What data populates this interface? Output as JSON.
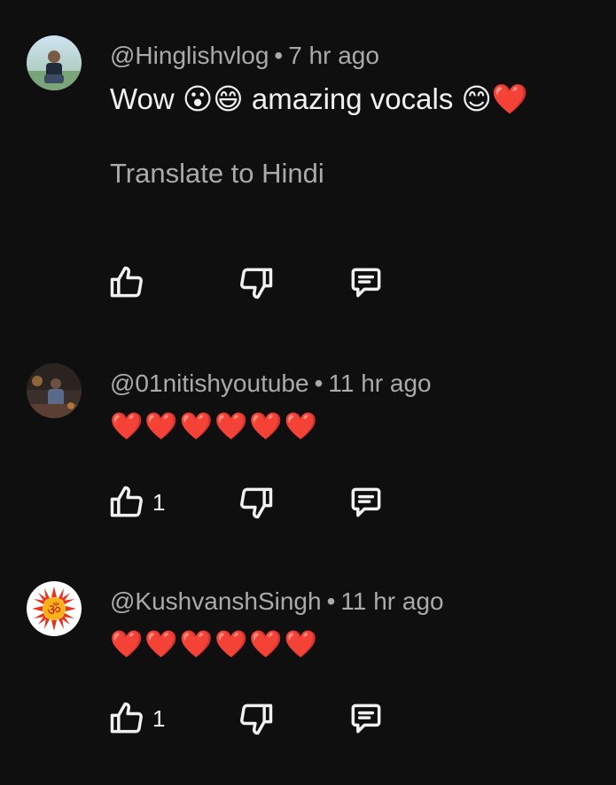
{
  "comments": [
    {
      "author": "@Hinglishvlog",
      "separator": "•",
      "time": "7 hr ago",
      "text": "Wow 😮😄 amazing vocals 😊❤️",
      "translate_label": "Translate to Hindi",
      "like_count": ""
    },
    {
      "author": "@01nitishyoutube",
      "separator": "•",
      "time": "11 hr ago",
      "text": "❤️❤️❤️❤️❤️❤️",
      "like_count": "1"
    },
    {
      "author": "@KushvanshSingh",
      "separator": "•",
      "time": "11 hr ago",
      "text": "❤️❤️❤️❤️❤️❤️",
      "like_count": "1"
    }
  ],
  "icons": {
    "like": "thumbs-up-icon",
    "dislike": "thumbs-down-icon",
    "reply": "reply-comment-icon",
    "avatar_3_symbol": "ॐ"
  },
  "colors": {
    "background": "#0f0f0f",
    "meta_text": "#aaaaaa",
    "primary_text": "#f1f1f1",
    "heart": "#e8262b"
  }
}
